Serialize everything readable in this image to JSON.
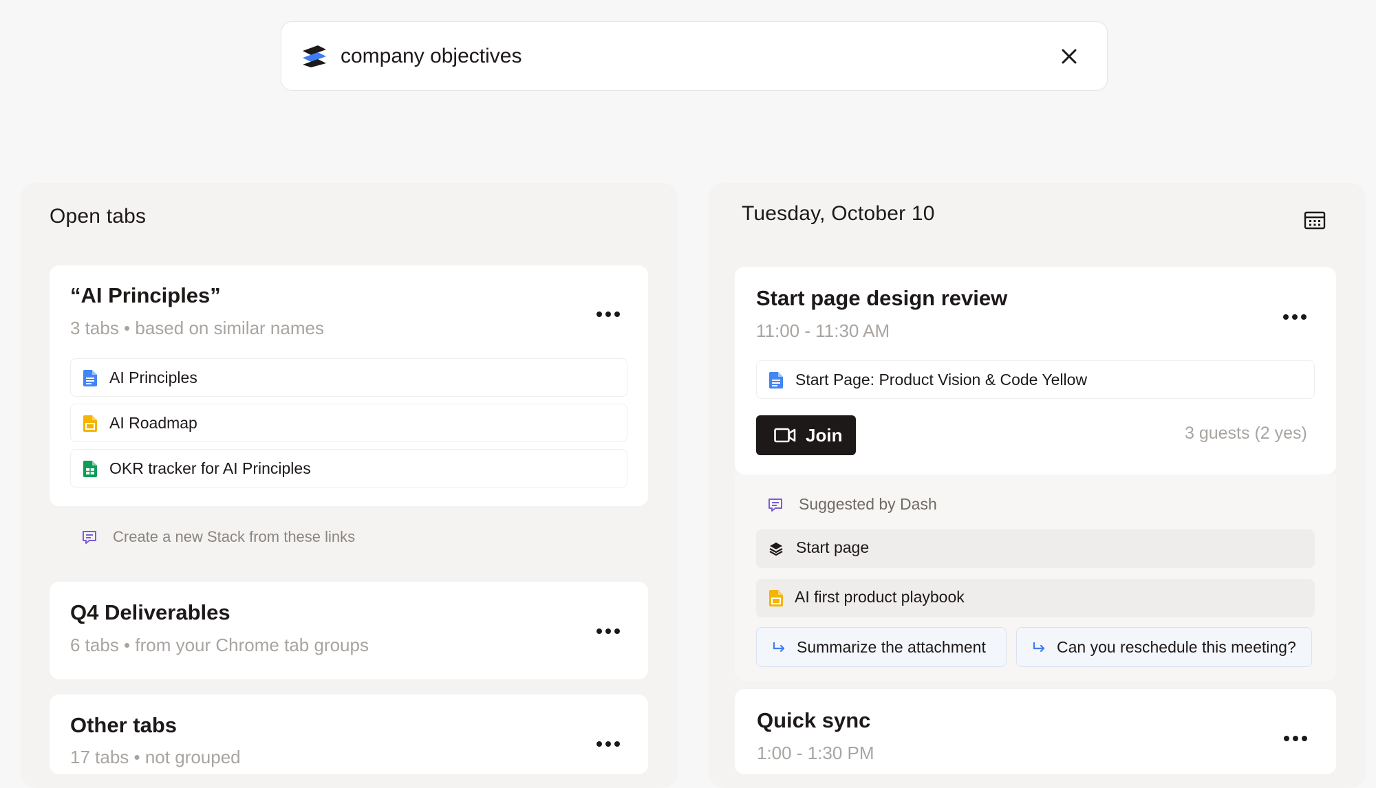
{
  "search": {
    "value": "company objectives",
    "logo_icon": "dash-logo-icon",
    "close_icon": "close-icon"
  },
  "open_tabs": {
    "title": "Open tabs",
    "groups": [
      {
        "title": "“AI Principles”",
        "subtitle": "3 tabs • based on similar names",
        "links": [
          {
            "label": "AI Principles",
            "icon": "google-doc-icon",
            "color": "#4285f4"
          },
          {
            "label": "AI Roadmap",
            "icon": "google-slides-icon",
            "color": "#f4b400"
          },
          {
            "label": "OKR tracker for AI Principles",
            "icon": "google-sheets-icon",
            "color": "#0f9d58"
          }
        ],
        "stack_hint": "Create a new Stack from these links"
      },
      {
        "title": "Q4 Deliverables",
        "subtitle": "6 tabs • from your Chrome tab groups"
      },
      {
        "title": "Other tabs",
        "subtitle": "17 tabs • not grouped"
      }
    ]
  },
  "calendar": {
    "date": "Tuesday, October 10",
    "calendar_icon": "calendar-icon",
    "events": [
      {
        "title": "Start page design review",
        "time": "11:00 - 11:30 AM",
        "attachment": "Start Page: Product Vision & Code Yellow",
        "join_label": "Join",
        "guests": "3 guests (2 yes)",
        "suggested_label": "Suggested by Dash",
        "suggestions": [
          {
            "label": "Start page",
            "icon": "stack-icon"
          },
          {
            "label": "AI first product playbook",
            "icon": "google-slides-icon"
          }
        ],
        "actions": [
          {
            "label": "Summarize the attachment"
          },
          {
            "label": "Can you reschedule this meeting?"
          }
        ]
      },
      {
        "title": "Quick sync",
        "time": "1:00 - 1:30 PM"
      }
    ]
  },
  "colors": {
    "accent_blue": "#4285f4",
    "slides_yellow": "#f4b400",
    "sheets_green": "#0f9d58",
    "dash_purple": "#7b5cd6",
    "join_bg": "#1e1919"
  }
}
